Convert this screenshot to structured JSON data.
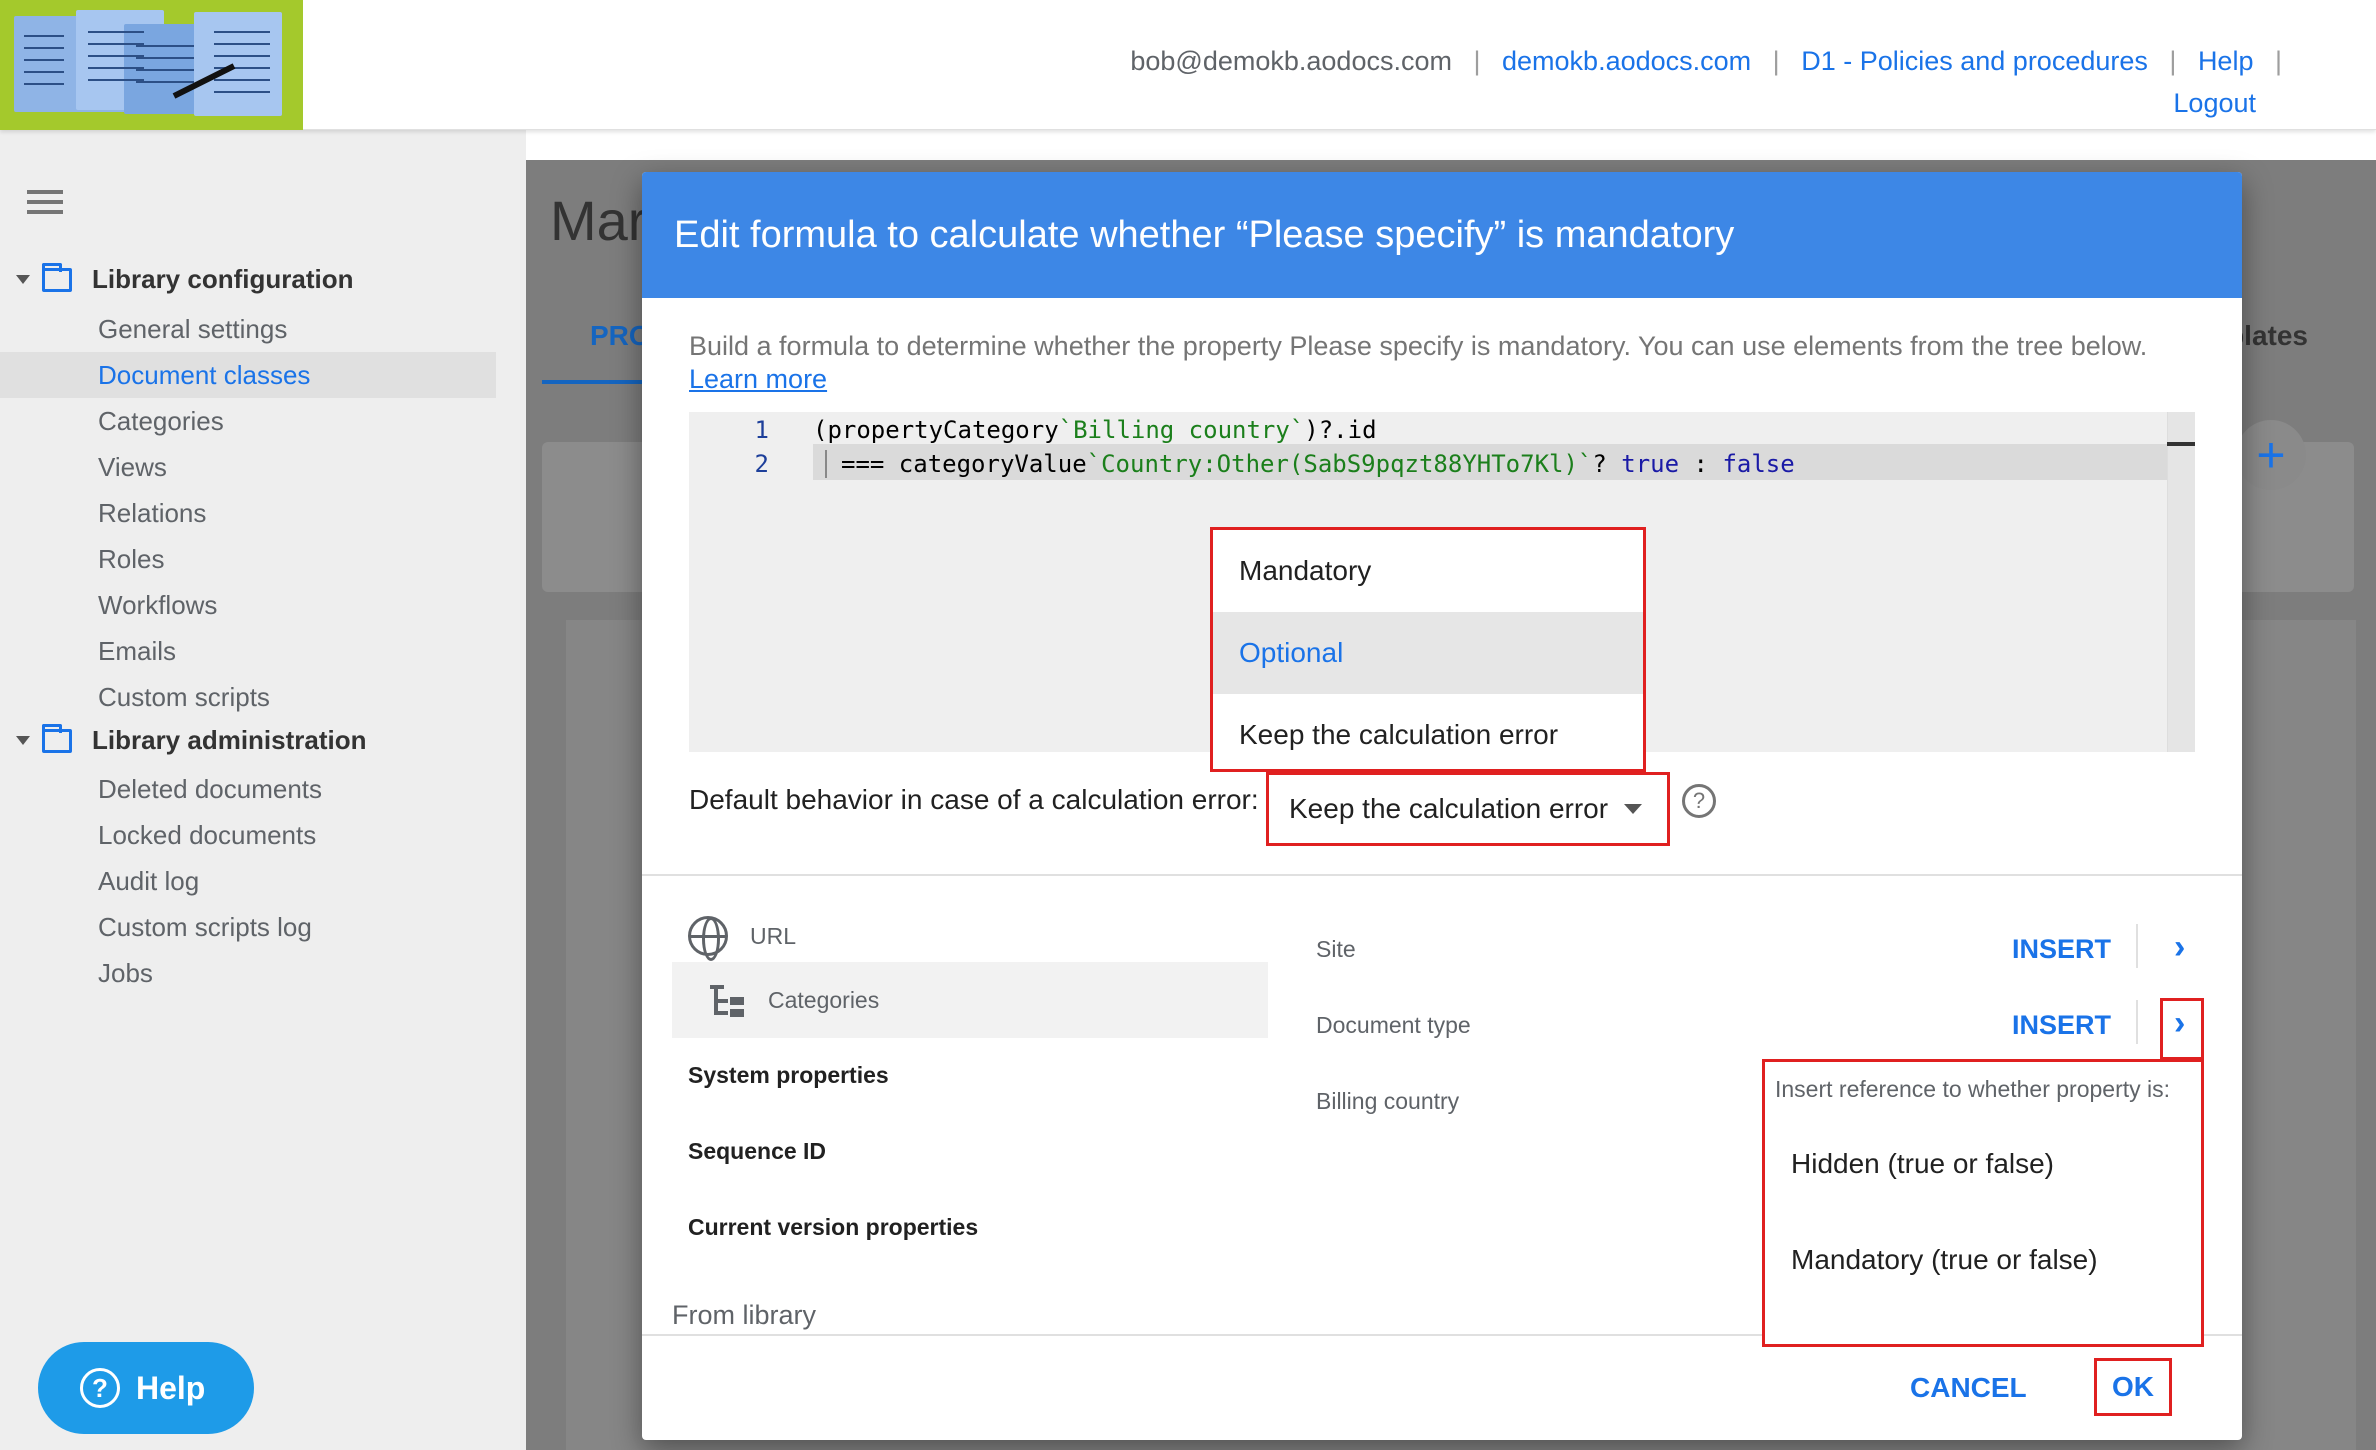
{
  "header": {
    "user_email": "bob@demokb.aodocs.com",
    "domain_link": "demokb.aodocs.com",
    "library_link": "D1 - Policies and procedures",
    "help_link": "Help",
    "logout_link": "Logout"
  },
  "sidebar": {
    "section_config": "Library configuration",
    "config_items": [
      {
        "label": "General settings"
      },
      {
        "label": "Document classes",
        "active": true
      },
      {
        "label": "Categories"
      },
      {
        "label": "Views"
      },
      {
        "label": "Relations"
      },
      {
        "label": "Roles"
      },
      {
        "label": "Workflows"
      },
      {
        "label": "Emails"
      },
      {
        "label": "Custom scripts"
      }
    ],
    "section_admin": "Library administration",
    "admin_items": [
      {
        "label": "Deleted documents"
      },
      {
        "label": "Locked documents"
      },
      {
        "label": "Audit log"
      },
      {
        "label": "Custom scripts log"
      },
      {
        "label": "Jobs"
      }
    ],
    "help_button": "Help"
  },
  "background": {
    "page_title_partial": "Mar",
    "tab_partial": "PRO",
    "tab_right_partial": "plates"
  },
  "dialog": {
    "title": "Edit formula to calculate whether “Please specify” is mandatory",
    "description": "Build a formula to determine whether the property Please specify is mandatory. You can use elements from the tree below.",
    "learn_more": "Learn more",
    "code": {
      "line1_num": "1",
      "line2_num": "2",
      "line1_a": "(propertyCategory",
      "line1_str": "`Billing country`",
      "line1_b": ")?.id",
      "line2_a": "=== categoryValue",
      "line2_str": "`Country:Other(SabS9pqzt88YHTo7Kl)`",
      "line2_b": "? ",
      "line2_true": "true",
      "line2_colon": " : ",
      "line2_false": "false"
    },
    "error_behavior_label": "Default behavior in case of a calculation error:",
    "error_behavior_value": "Keep the calculation error",
    "error_behavior_options": [
      "Mandatory",
      "Optional",
      "Keep the calculation error"
    ],
    "tree": {
      "url": "URL",
      "categories": "Categories",
      "system_properties": "System properties",
      "sequence_id": "Sequence ID",
      "current_version_properties": "Current version properties",
      "from_library": "From library"
    },
    "props": {
      "site": "Site",
      "document_type": "Document type",
      "billing_country": "Billing country",
      "insert_label": "INSERT"
    },
    "submenu": {
      "header": "Insert reference to whether property is:",
      "options": [
        "Hidden (true or false)",
        "Mandatory (true or false)"
      ]
    },
    "cancel": "CANCEL",
    "ok": "OK"
  },
  "colors": {
    "accent": "#1a73e8",
    "dialog_header": "#3d87e6",
    "highlight_box": "#e02020",
    "logo_bg": "#a4c92c"
  }
}
